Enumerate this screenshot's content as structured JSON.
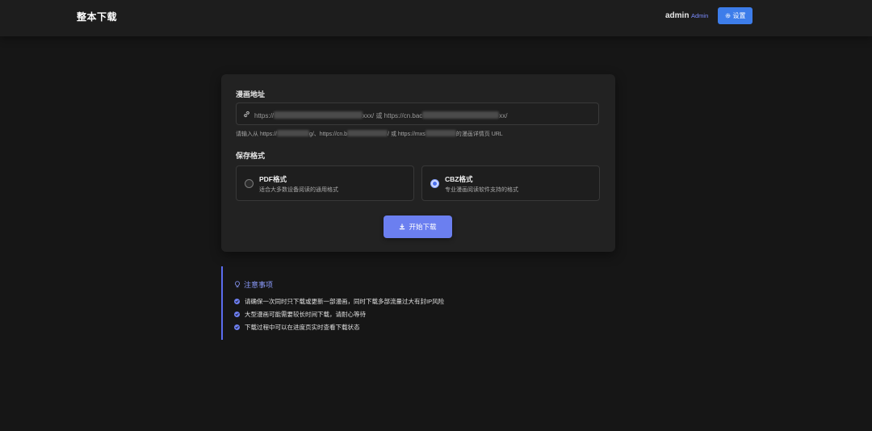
{
  "navbar": {
    "brand": "整本下载",
    "user_name": "admin",
    "user_role": "Admin",
    "settings_label": "设置"
  },
  "form": {
    "url_label": "漫画地址",
    "url_placeholder": "https://...xxx/ 或 https://cn.bac...xx/",
    "url_placeholder_parts": [
      "https://",
      "xxx/ 或 https://cn.bac",
      "xx/"
    ],
    "hint_parts": [
      "请输入从 https://",
      "g/、https://cn.b",
      "/ 或 https://mxs",
      "的漫画详情页 URL"
    ],
    "format_label": "保存格式",
    "formats": [
      {
        "title": "PDF格式",
        "desc": "适合大多数设备阅读的通用格式",
        "selected": false
      },
      {
        "title": "CBZ格式",
        "desc": "专业漫画阅读软件支持的格式",
        "selected": true
      }
    ],
    "download_label": "开始下载"
  },
  "notice": {
    "title": "注意事项",
    "items": [
      "请确保一次同时只下载或更新一部漫画，同时下载多部流量过大有封IP风险",
      "大型漫画可能需要较长时间下载，请耐心等待",
      "下载过程中可以在进度页实时查看下载状态"
    ]
  },
  "colors": {
    "background": "#161616",
    "card": "#222222",
    "accent": "#6b7ff0",
    "settings_button": "#3d7dea"
  },
  "icons": {
    "settings": "gear-icon",
    "url": "link-icon",
    "download": "download-icon",
    "notice": "lightbulb-icon",
    "notice_item": "check-circle-icon"
  }
}
